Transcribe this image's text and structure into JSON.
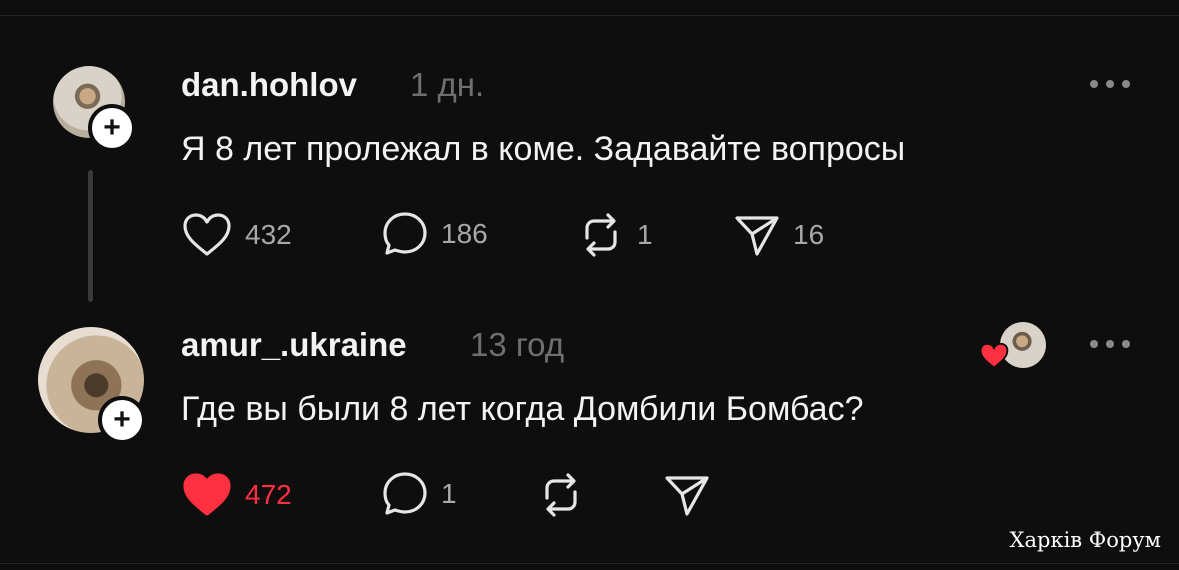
{
  "posts": [
    {
      "username": "dan.hohlov",
      "time": "1 дн.",
      "text": "Я 8 лет пролежал в коме. Задавайте вопросы",
      "actions": {
        "likes": "432",
        "comments": "186",
        "reposts": "1",
        "shares": "16"
      },
      "liked": false
    },
    {
      "username": "amur_.ukraine",
      "time": "13 год",
      "text": "Где вы были 8 лет когда Домбили Бомбас?",
      "actions": {
        "likes": "472",
        "comments": "1",
        "reposts": "",
        "shares": ""
      },
      "liked": true
    }
  ],
  "watermark": "Харків Форум",
  "colors": {
    "background": "#0f0e0f",
    "like_active": "#ff3040",
    "muted": "#a8a8a8",
    "time": "#6f6f6f"
  },
  "icons": [
    "heart-icon",
    "comment-icon",
    "repost-icon",
    "share-icon",
    "plus-icon",
    "more-icon"
  ]
}
